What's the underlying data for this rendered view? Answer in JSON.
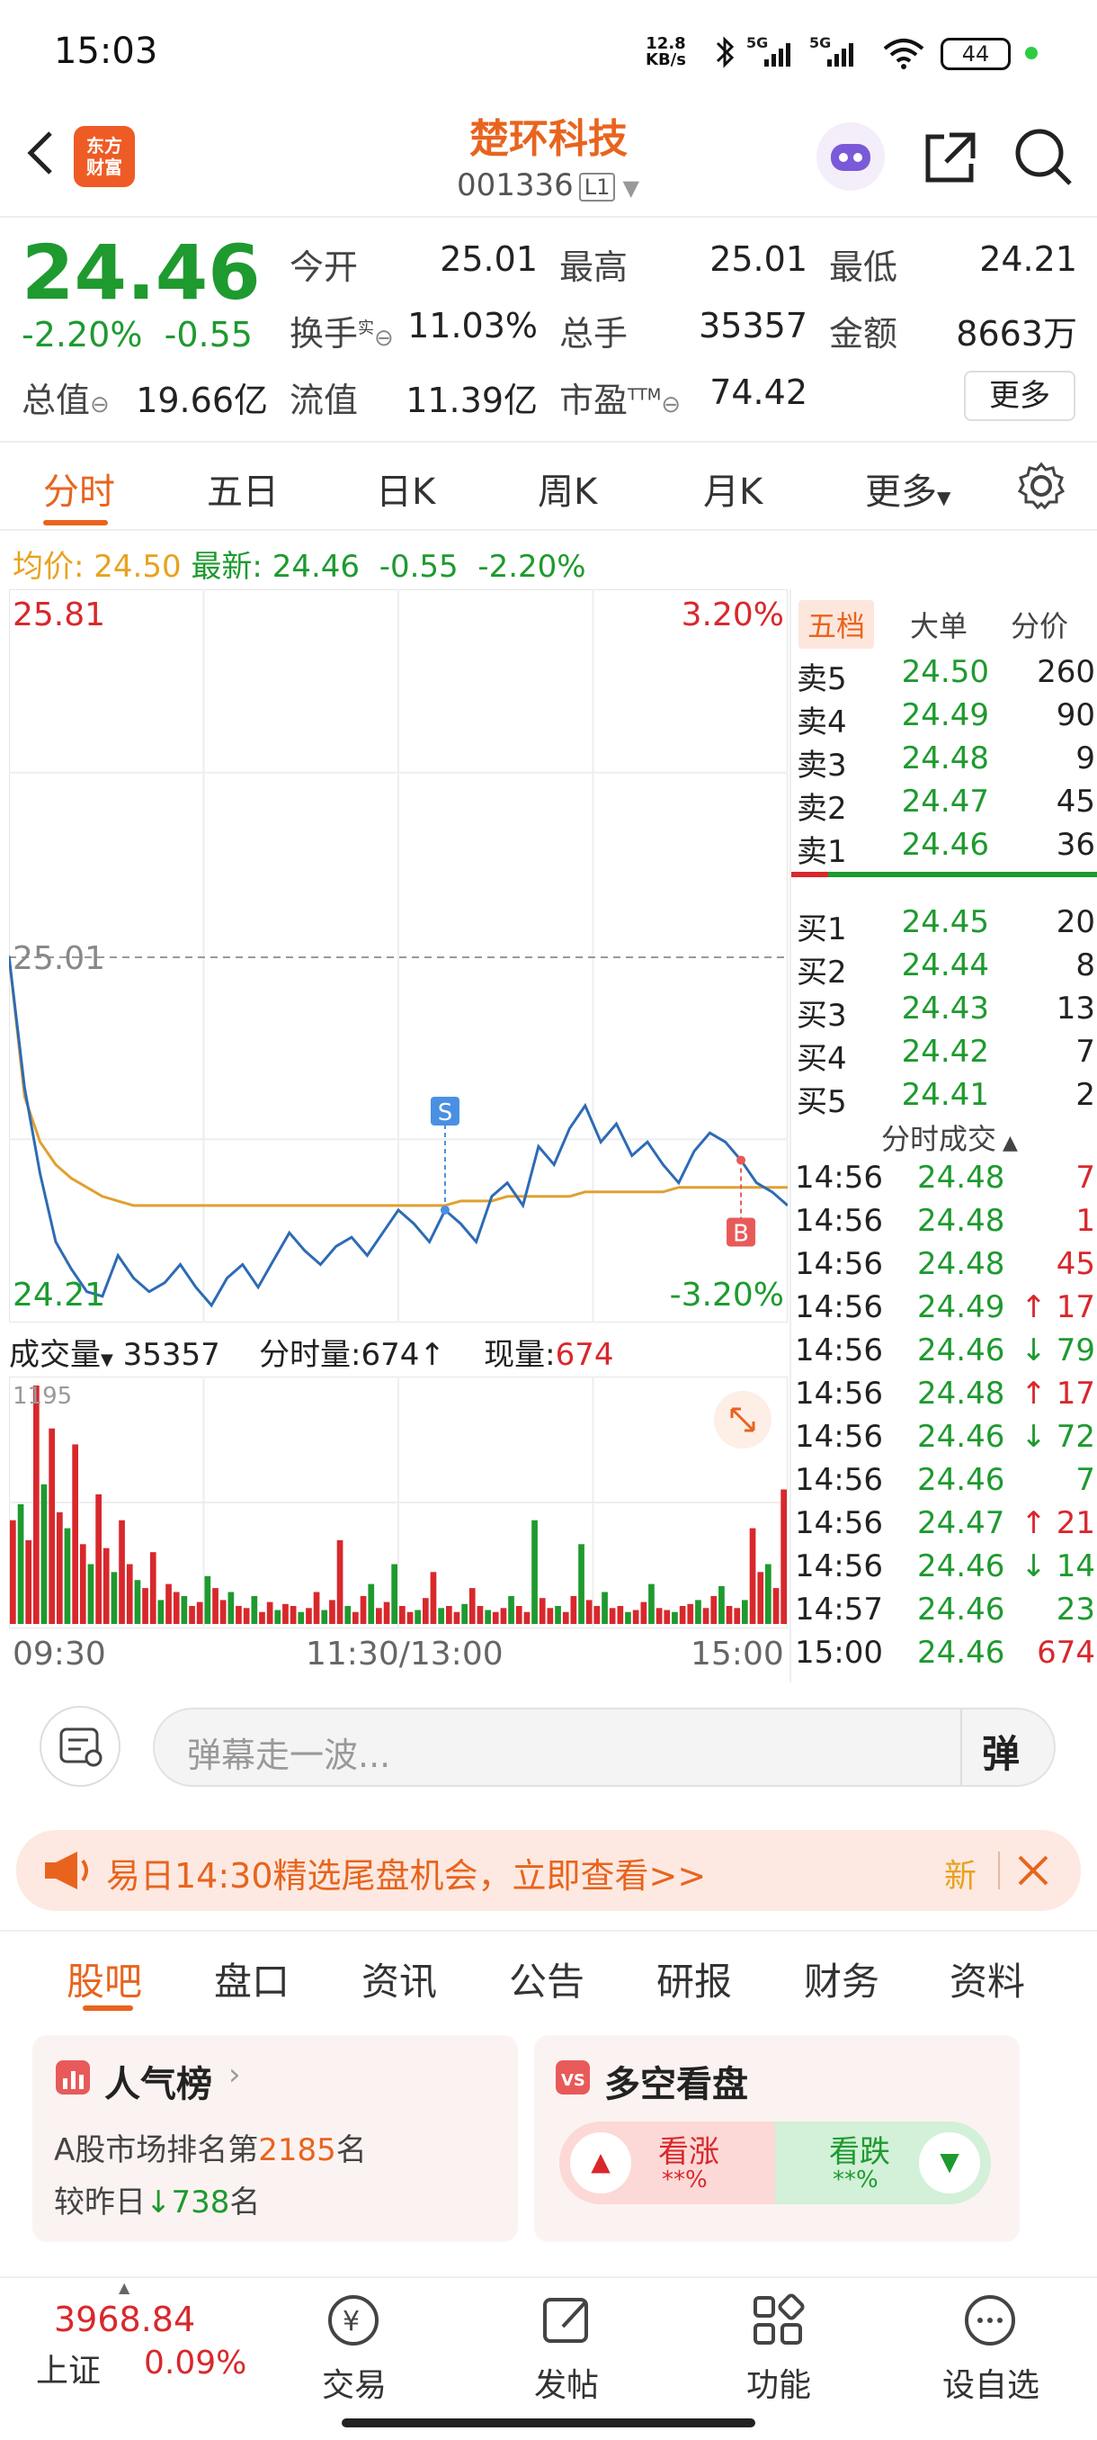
{
  "status_bar": {
    "time": "15:03",
    "net_speed": "12.8",
    "net_unit": "KB/s",
    "signal1": "5G",
    "signal2": "5G",
    "battery": "44"
  },
  "header": {
    "logo_line1": "东方",
    "logo_line2": "财富",
    "stock_name": "楚环科技",
    "stock_code": "001336",
    "level": "L1"
  },
  "quote": {
    "price": "24.46",
    "change_pct": "-2.20%",
    "change": "-0.55",
    "open_label": "今开",
    "open": "25.01",
    "high_label": "最高",
    "high": "25.01",
    "low_label": "最低",
    "low": "24.21",
    "turnover_label": "换手",
    "turnover_sup": "实",
    "turnover": "11.03%",
    "volume_label": "总手",
    "volume": "35357",
    "amount_label": "金额",
    "amount": "8663万",
    "mktcap_label": "总值",
    "mktcap": "19.66亿",
    "float_label": "流值",
    "float": "11.39亿",
    "pe_label": "市盈",
    "pe_sup": "TTM",
    "pe": "74.42",
    "more": "更多"
  },
  "tabs": [
    "分时",
    "五日",
    "日K",
    "周K",
    "月K",
    "更多"
  ],
  "avg_line": {
    "avg_label": "均价:",
    "avg": "24.50",
    "latest_label": "最新:",
    "latest": "24.46",
    "change": "-0.55",
    "pct": "-2.20%"
  },
  "chart_data": {
    "type": "line",
    "y_top_label": "25.81",
    "y_bottom_label": "24.21",
    "y_mid_label": "25.01",
    "pct_top": "3.20%",
    "pct_bottom": "-3.20%",
    "ylim": [
      24.21,
      25.81
    ],
    "prev_close": 25.01,
    "x_labels": [
      "09:30",
      "11:30/13:00",
      "15:00"
    ],
    "series": [
      {
        "values": [
          25.01,
          24.72,
          24.53,
          24.38,
          24.32,
          24.27,
          24.26,
          24.35,
          24.3,
          24.27,
          24.29,
          24.33,
          24.28,
          24.24,
          24.3,
          24.33,
          24.28,
          24.34,
          24.4,
          24.36,
          24.33,
          24.37,
          24.39,
          24.35,
          24.4,
          24.45,
          24.42,
          24.38,
          24.45,
          24.42,
          24.38,
          24.48,
          24.51,
          24.46,
          24.59,
          24.55,
          24.63,
          24.68,
          24.6,
          24.64,
          24.57,
          24.6,
          24.55,
          24.51,
          24.58,
          24.62,
          24.6,
          24.56,
          24.51,
          24.49,
          24.46
        ]
      },
      {
        "values": [
          25.01,
          24.7,
          24.6,
          24.55,
          24.52,
          24.5,
          24.48,
          24.47,
          24.46,
          24.46,
          24.46,
          24.46,
          24.46,
          24.46,
          24.46,
          24.46,
          24.46,
          24.46,
          24.46,
          24.46,
          24.46,
          24.46,
          24.46,
          24.46,
          24.46,
          24.46,
          24.46,
          24.46,
          24.46,
          24.47,
          24.47,
          24.47,
          24.48,
          24.48,
          24.48,
          24.48,
          24.48,
          24.49,
          24.49,
          24.49,
          24.49,
          24.49,
          24.49,
          24.5,
          24.5,
          24.5,
          24.5,
          24.5,
          24.5,
          24.5,
          24.5
        ]
      }
    ],
    "markers": [
      {
        "label": "S",
        "index": 28
      },
      {
        "label": "B",
        "index": 47
      }
    ],
    "volume": {
      "label": "成交量",
      "total": "35357",
      "last_label": "分时量:",
      "last": "674",
      "now_label": "现量:",
      "now": "674",
      "max_label": "1195",
      "ymax": 1195,
      "values": [
        520,
        600,
        420,
        1195,
        700,
        980,
        560,
        480,
        900,
        400,
        300,
        650,
        380,
        260,
        520,
        300,
        220,
        180,
        360,
        120,
        200,
        160,
        140,
        90,
        110,
        240,
        180,
        120,
        160,
        90,
        80,
        140,
        60,
        110,
        70,
        100,
        90,
        60,
        80,
        160,
        70,
        120,
        420,
        90,
        60,
        140,
        200,
        80,
        110,
        300,
        90,
        60,
        70,
        130,
        260,
        80,
        90,
        60,
        100,
        180,
        90,
        70,
        60,
        80,
        140,
        90,
        60,
        520,
        130,
        80,
        90,
        60,
        140,
        400,
        120,
        90,
        160,
        80,
        90,
        60,
        70,
        110,
        200,
        80,
        70,
        60,
        90,
        100,
        120,
        80,
        140,
        190,
        90,
        80,
        120,
        480,
        260,
        300,
        180,
        674
      ]
    }
  },
  "order_book": {
    "tabs": [
      "五档",
      "大单",
      "分价"
    ],
    "asks": [
      {
        "label": "卖5",
        "price": "24.50",
        "vol": "260"
      },
      {
        "label": "卖4",
        "price": "24.49",
        "vol": "90"
      },
      {
        "label": "卖3",
        "price": "24.48",
        "vol": "9"
      },
      {
        "label": "卖2",
        "price": "24.47",
        "vol": "45"
      },
      {
        "label": "卖1",
        "price": "24.46",
        "vol": "36"
      }
    ],
    "bids": [
      {
        "label": "买1",
        "price": "24.45",
        "vol": "20"
      },
      {
        "label": "买2",
        "price": "24.44",
        "vol": "8"
      },
      {
        "label": "买3",
        "price": "24.43",
        "vol": "13"
      },
      {
        "label": "买4",
        "price": "24.42",
        "vol": "7"
      },
      {
        "label": "买5",
        "price": "24.41",
        "vol": "2"
      }
    ],
    "trades_label": "分时成交",
    "trades": [
      {
        "time": "14:56",
        "price": "24.48",
        "arrow": "",
        "vol": "7"
      },
      {
        "time": "14:56",
        "price": "24.48",
        "arrow": "",
        "vol": "1"
      },
      {
        "time": "14:56",
        "price": "24.48",
        "arrow": "",
        "vol": "45"
      },
      {
        "time": "14:56",
        "price": "24.49",
        "arrow": "↑",
        "vol": "17"
      },
      {
        "time": "14:56",
        "price": "24.46",
        "arrow": "↓",
        "vol": "79"
      },
      {
        "time": "14:56",
        "price": "24.48",
        "arrow": "↑",
        "vol": "17"
      },
      {
        "time": "14:56",
        "price": "24.46",
        "arrow": "↓",
        "vol": "72"
      },
      {
        "time": "14:56",
        "price": "24.46",
        "arrow": "",
        "vol": "7"
      },
      {
        "time": "14:56",
        "price": "24.47",
        "arrow": "↑",
        "vol": "21"
      },
      {
        "time": "14:56",
        "price": "24.46",
        "arrow": "↓",
        "vol": "14"
      },
      {
        "time": "14:57",
        "price": "24.46",
        "arrow": "",
        "vol": "23"
      },
      {
        "time": "15:00",
        "price": "24.46",
        "arrow": "",
        "vol": "674"
      }
    ]
  },
  "danmu": {
    "placeholder": "弹幕走一波...",
    "btn": "弹"
  },
  "banner": {
    "text": "易日14:30精选尾盘机会，立即查看>>",
    "badge": "新"
  },
  "lower_tabs": [
    "股吧",
    "盘口",
    "资讯",
    "公告",
    "研报",
    "财务",
    "资料"
  ],
  "card_popular": {
    "title": "人气榜",
    "line1_pre": "A股市场排名第",
    "rank": "2185",
    "line1_post": "名",
    "line2_pre": "较昨日",
    "delta": "738",
    "line2_post": "名"
  },
  "card_sentiment": {
    "title": "多空看盘",
    "up": "看涨",
    "up_val": "**%",
    "down": "看跌",
    "down_val": "**%"
  },
  "bottom_nav": {
    "index_value": "3968.84",
    "index_name": "上证",
    "index_pct": "0.09%",
    "items": [
      "交易",
      "发帖",
      "功能",
      "设自选"
    ]
  }
}
